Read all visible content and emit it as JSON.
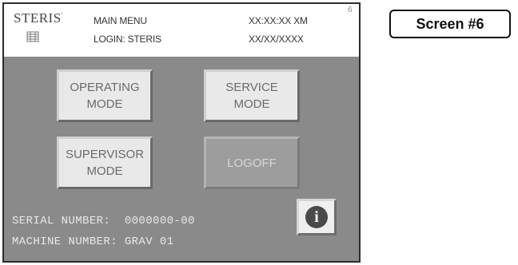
{
  "header": {
    "brand": "STERIS",
    "brand_mark": "'",
    "menu_title": "MAIN MENU",
    "login": "LOGIN: STERIS",
    "time": "XX:XX:XX XM",
    "date": "XX/XX/XXXX",
    "screen_number": "6",
    "logo_icon": "steris-logo-icon"
  },
  "buttons": {
    "operating": {
      "line1": "OPERATING",
      "line2": "MODE"
    },
    "service": {
      "line1": "SERVICE",
      "line2": "MODE"
    },
    "supervisor": {
      "line1": "SUPERVISOR",
      "line2": "MODE"
    },
    "logoff": {
      "label": "LOGOFF",
      "state": "disabled"
    }
  },
  "footer": {
    "serial": "SERIAL NUMBER:  0000000-00",
    "machine": "MACHINE NUMBER: GRAV 01",
    "info_icon": "info-icon"
  },
  "screen_label": "Screen #6"
}
